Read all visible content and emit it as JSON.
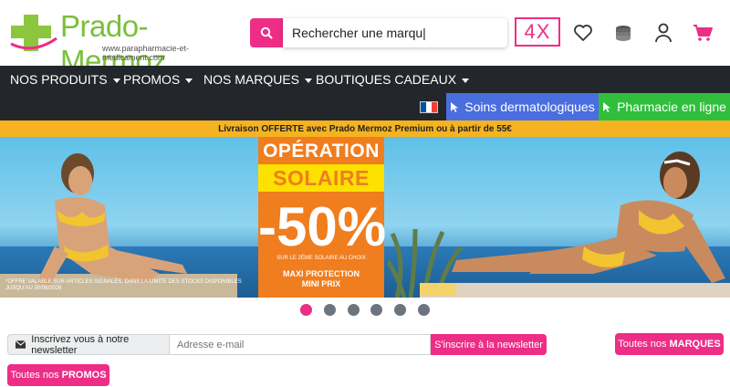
{
  "logo": {
    "name": "Prado-Mermoz",
    "subtitle": "www.parapharmacie-et-medicament.com"
  },
  "search": {
    "value": "Rechercher une marqu|",
    "placeholder": "Rechercher une marque"
  },
  "header": {
    "badge": "4X"
  },
  "nav": {
    "items": [
      {
        "label": "NOS PRODUITS"
      },
      {
        "label": "PROMOS"
      },
      {
        "label": "NOS MARQUES"
      },
      {
        "label": "BOUTIQUES CADEAUX"
      }
    ]
  },
  "subnav": {
    "soins_label": "Soins dermatologiques",
    "pharmacie_label": "Pharmacie en ligne"
  },
  "promo_bar": {
    "text": "Livraison OFFERTE avec Prado Mermoz Premium ou à partir de 55€"
  },
  "hero": {
    "title1": "OPÉRATION",
    "title2": "SOLAIRE",
    "discount": "-50%",
    "discount_note": "SUR LE 2ÈME SOLAIRE AU CHOIX",
    "maxi_line1": "MAXI PROTECTION",
    "maxi_line2": "MINI PRIX",
    "offer_note": "*OFFRE VALABLE SUR ARTICLES SIGNALÉS, DANS LA LIMITE DES STOCKS DISPONIBLES JUSQU'AU 30/06/2026"
  },
  "carousel": {
    "total": 6,
    "active": 1
  },
  "newsletter": {
    "label": "Inscrivez vous à notre newsletter",
    "placeholder": "Adresse e-mail",
    "button": "S'inscrire à la newsletter"
  },
  "buttons": {
    "marques_prefix": "Toutes nos",
    "marques_bold": "MARQUES",
    "promos_prefix": "Toutes nos",
    "promos_bold": "PROMOS"
  },
  "colors": {
    "pink": "#ee2d86",
    "nav_bg": "#23272b",
    "blue": "#4a6ee0",
    "green": "#2fbf3d",
    "yellow": "#f5b321",
    "orange": "#f07d1e"
  },
  "icons": [
    "search-icon",
    "heart-icon",
    "coins-icon",
    "user-icon",
    "cart-icon",
    "cursor-icon",
    "envelope-icon"
  ]
}
